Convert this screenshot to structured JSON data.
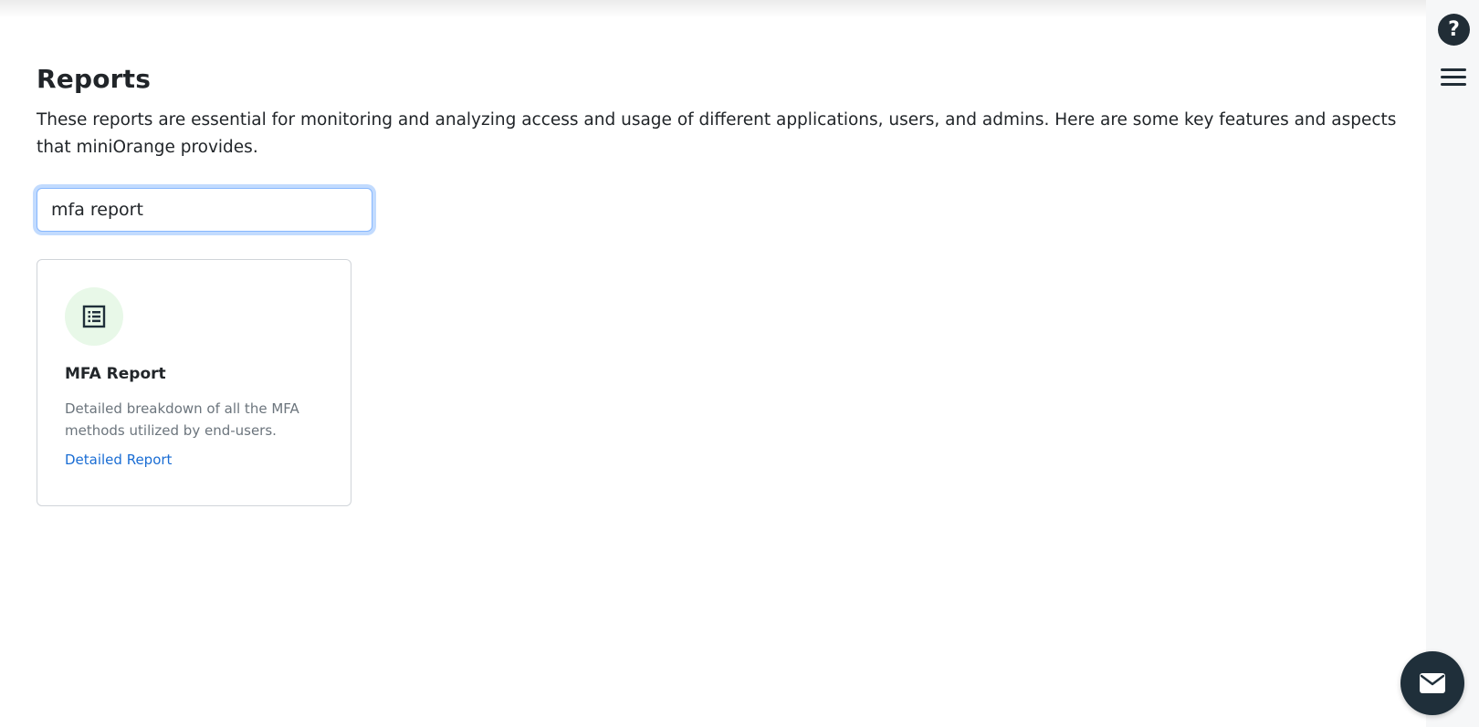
{
  "page": {
    "title": "Reports",
    "description": "These reports are essential for monitoring and analyzing access and usage of different applications, users, and admins. Here are some key features and aspects that miniOrange provides."
  },
  "search": {
    "value": "mfa report"
  },
  "cards": [
    {
      "icon": "list-report-icon",
      "title": "MFA Report",
      "description": "Detailed breakdown of all the MFA methods utilized by end-users.",
      "link_label": "Detailed Report"
    }
  ],
  "right_rail": {
    "help_glyph": "?",
    "help_icon": "question-circle-icon",
    "menu_icon": "hamburger-menu-icon"
  },
  "fab": {
    "icon": "envelope-icon"
  },
  "colors": {
    "accent_link": "#1a6dd4",
    "icon_circle_bg": "#e8f8e8",
    "dark_button": "#1f2f3a",
    "focus_ring": "#86b7fe"
  }
}
